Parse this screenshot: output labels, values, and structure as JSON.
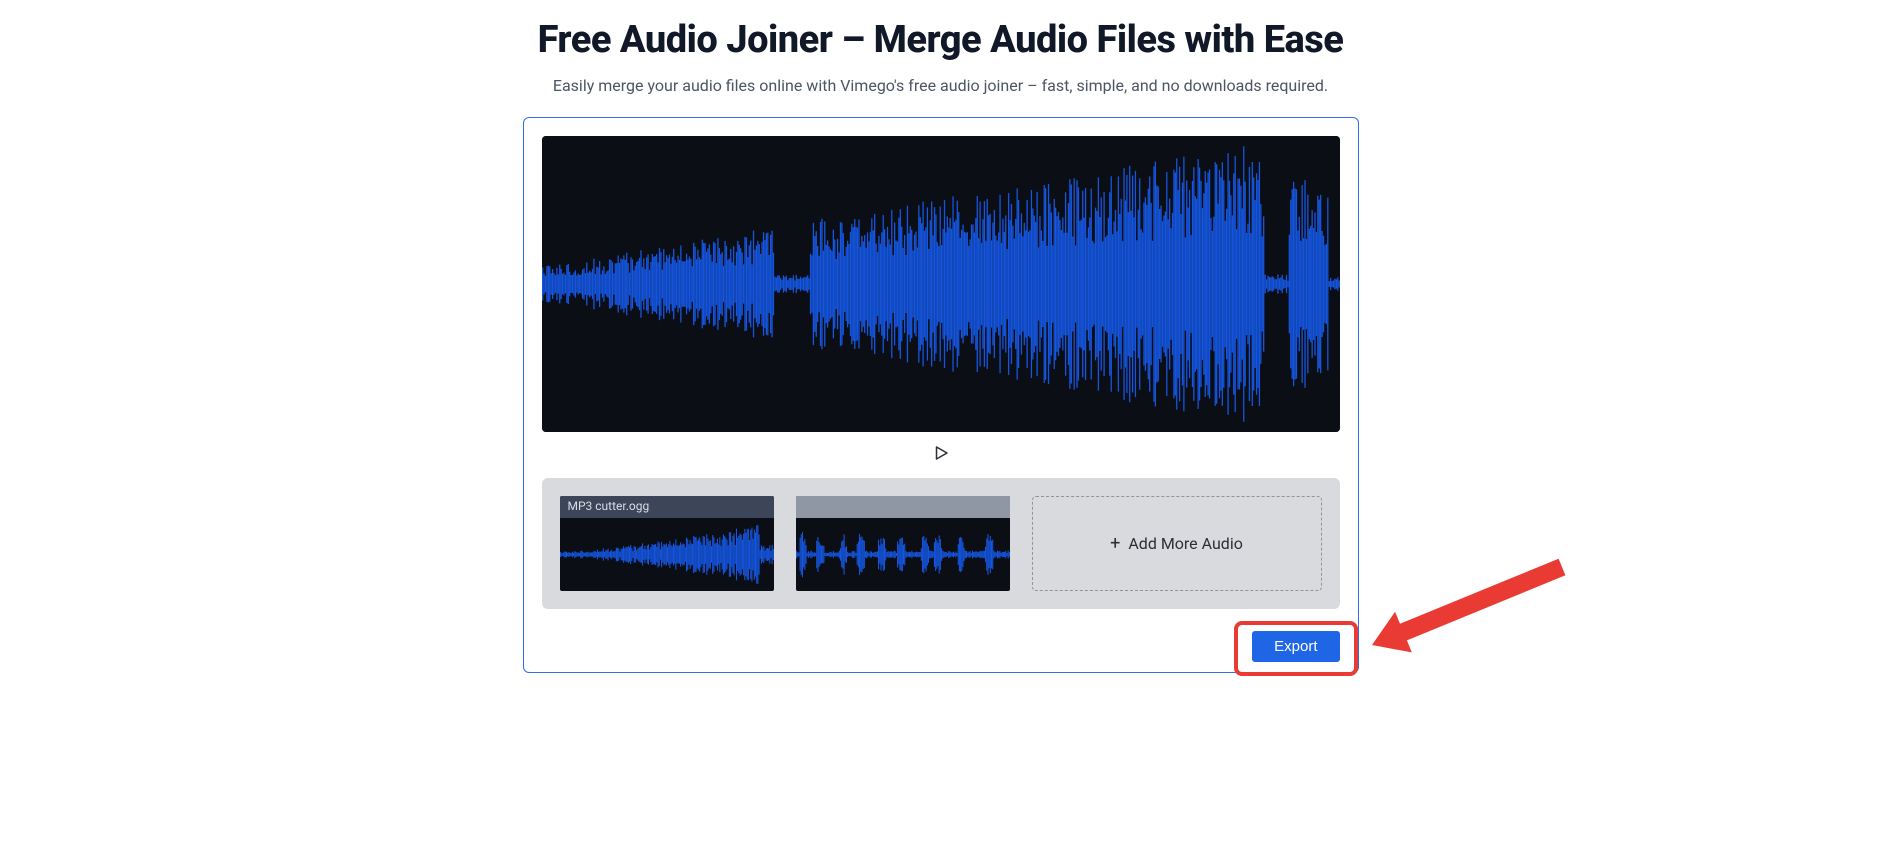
{
  "title": "Free Audio Joiner – Merge Audio Files with Ease",
  "subtitle": "Easily merge your audio files online with Vimego's free audio joiner – fast, simple, and no downloads required.",
  "play_label": "Play",
  "clips": [
    {
      "name": "MP3 cutter.ogg"
    },
    {
      "name": ""
    }
  ],
  "add_more_label": "Add More Audio",
  "add_more_plus": "+",
  "export_label": "Export",
  "colors": {
    "accent": "#1e66e5",
    "panel_border": "#2f6fec",
    "waveform": "#1556e0",
    "bg_dark": "#0b0e14",
    "tray_bg": "#d8dade",
    "highlight": "#e93a33"
  }
}
